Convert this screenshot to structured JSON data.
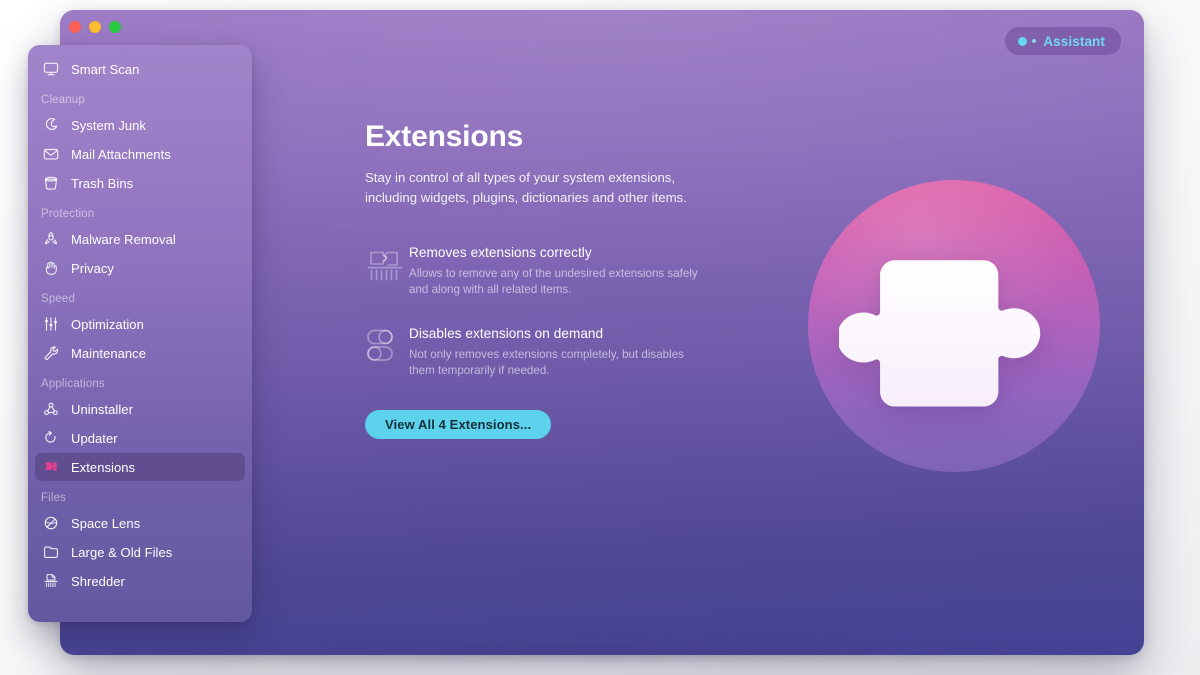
{
  "window": {
    "traffic_lights": [
      {
        "name": "close",
        "color": "#ff5f57"
      },
      {
        "name": "minimize",
        "color": "#febc2e"
      },
      {
        "name": "zoom",
        "color": "#28c840"
      }
    ]
  },
  "assistant": {
    "label": "Assistant",
    "dot_color": "#66d8ef",
    "text_color": "#6fd9f0"
  },
  "sidebar": {
    "groups": [
      {
        "label": "",
        "items": [
          {
            "label": "Smart Scan",
            "icon": "display-icon",
            "selected": false
          }
        ]
      },
      {
        "label": "Cleanup",
        "items": [
          {
            "label": "System Junk",
            "icon": "broom-icon",
            "selected": false
          },
          {
            "label": "Mail Attachments",
            "icon": "envelope-icon",
            "selected": false
          },
          {
            "label": "Trash Bins",
            "icon": "trash-bin-icon",
            "selected": false
          }
        ]
      },
      {
        "label": "Protection",
        "items": [
          {
            "label": "Malware Removal",
            "icon": "biohazard-icon",
            "selected": false
          },
          {
            "label": "Privacy",
            "icon": "hand-icon",
            "selected": false
          }
        ]
      },
      {
        "label": "Speed",
        "items": [
          {
            "label": "Optimization",
            "icon": "sliders-icon",
            "selected": false
          },
          {
            "label": "Maintenance",
            "icon": "wrench-icon",
            "selected": false
          }
        ]
      },
      {
        "label": "Applications",
        "items": [
          {
            "label": "Uninstaller",
            "icon": "app-uninstall-icon",
            "selected": false
          },
          {
            "label": "Updater",
            "icon": "refresh-arrow-icon",
            "selected": false
          },
          {
            "label": "Extensions",
            "icon": "puzzle-icon",
            "selected": true
          }
        ]
      },
      {
        "label": "Files",
        "items": [
          {
            "label": "Space Lens",
            "icon": "planet-lens-icon",
            "selected": false
          },
          {
            "label": "Large & Old Files",
            "icon": "folder-icon",
            "selected": false
          },
          {
            "label": "Shredder",
            "icon": "shredder-icon",
            "selected": false
          }
        ]
      }
    ],
    "selected_bg": "#46326999"
  },
  "main": {
    "title": "Extensions",
    "description": "Stay in control of all types of your system extensions, including widgets, plugins, dictionaries and other items.",
    "features": [
      {
        "icon": "puzzle-shredder-icon",
        "title": "Removes extensions correctly",
        "description": "Allows to remove any of the undesired extensions safely and along with all related items."
      },
      {
        "icon": "toggle-switches-icon",
        "title": "Disables extensions on demand",
        "description": "Not only removes extensions completely, but disables them temporarily if needed."
      }
    ],
    "primary_button": {
      "label": "View All 4 Extensions...",
      "bg_color": "#5cd2ec",
      "text_color": "#15303a"
    },
    "hero": {
      "icon": "puzzle-piece-hero-icon",
      "gradient_from": "#e05fa8",
      "gradient_to": "#7c63b8"
    }
  }
}
